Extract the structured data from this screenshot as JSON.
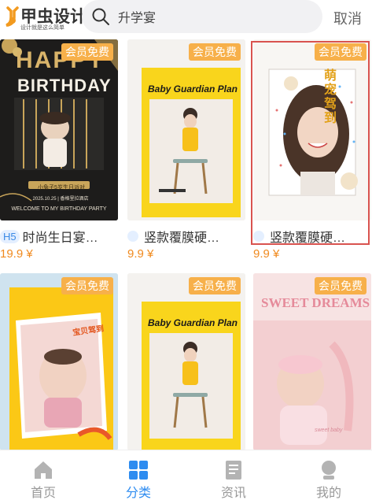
{
  "header": {
    "logo_text": "甲虫设计",
    "logo_slogan": "设计就是这么简单",
    "search_value": "升学宴",
    "cancel_label": "取消"
  },
  "cards": [
    {
      "tag": "H5",
      "title": "时尚生日宴…",
      "price": "19.9 ¥",
      "badge": "会员免费",
      "poster": {
        "heading": "HAPPY",
        "subheading": "BIRTHDAY",
        "caption": "小兔子5岁生日派对",
        "date": "2025.10.25 | 香格里拉酒店",
        "welcome": "WELCOME TO MY BIRTHDAY PARTY"
      }
    },
    {
      "tag": "",
      "title": "竖款覆膜硬壳…",
      "price": "9.9 ¥",
      "badge": "会员免费",
      "poster": {
        "heading": "Baby Guardian Plan"
      }
    },
    {
      "tag": "",
      "title": "竖款覆膜硬壳…",
      "price": "9.9 ¥",
      "badge": "会员免费",
      "poster": {
        "heading": "萌宠驾到"
      }
    },
    {
      "badge": "会员免费",
      "poster": {
        "heading": "宝贝驾到"
      }
    },
    {
      "badge": "会员免费",
      "poster": {
        "heading": "Baby Guardian Plan"
      }
    },
    {
      "badge": "会员免费",
      "poster": {
        "heading": "SWEET DREAMS",
        "caption": "sweet baby"
      }
    }
  ],
  "tabs": [
    {
      "label": "首页",
      "icon": "home-icon"
    },
    {
      "label": "分类",
      "icon": "grid-icon"
    },
    {
      "label": "资讯",
      "icon": "news-icon"
    },
    {
      "label": "我的",
      "icon": "user-icon"
    }
  ],
  "colors": {
    "accent": "#2e8cf0",
    "badge": "#f7b04a",
    "price": "#f08a1f",
    "selection": "#d9534f"
  }
}
